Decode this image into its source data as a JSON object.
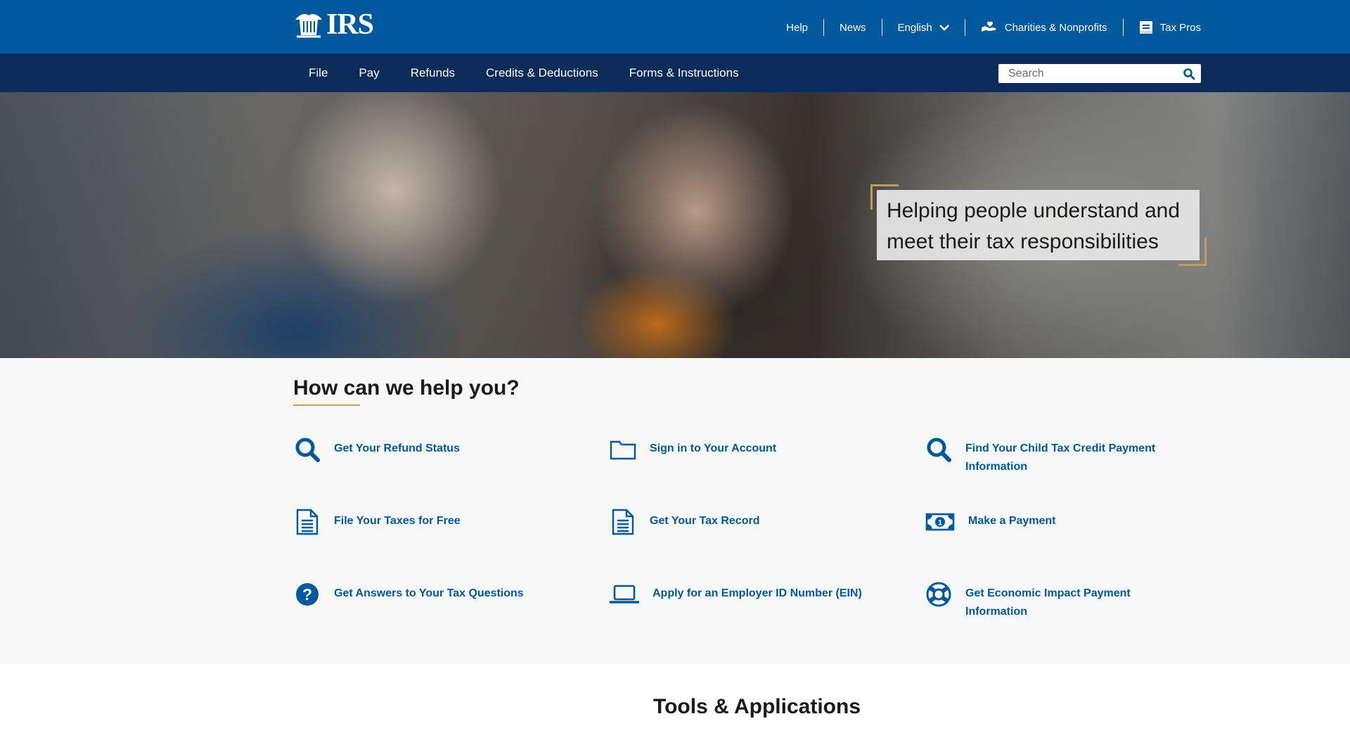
{
  "brand": {
    "logo_text": "IRS"
  },
  "utility_nav": {
    "help": "Help",
    "news": "News",
    "language": "English",
    "charities": "Charities & Nonprofits",
    "tax_pros": "Tax Pros"
  },
  "main_nav": {
    "items": [
      "File",
      "Pay",
      "Refunds",
      "Credits & Deductions",
      "Forms & Instructions"
    ]
  },
  "search": {
    "placeholder": "Search",
    "value": ""
  },
  "hero": {
    "line1": "Helping people understand and",
    "line2": "meet their tax responsibilities"
  },
  "help": {
    "title": "How can we help you?",
    "links": [
      {
        "label": "Get Your Refund Status",
        "icon": "search-icon"
      },
      {
        "label": "Sign in to Your Account",
        "icon": "folder-icon"
      },
      {
        "label": "Find Your Child Tax Credit Payment",
        "label2": "Information",
        "icon": "search-icon"
      },
      {
        "label": "File Your Taxes for Free",
        "icon": "document-icon"
      },
      {
        "label": "Get Your Tax Record",
        "icon": "document-icon"
      },
      {
        "label": "Make a Payment",
        "icon": "money-icon"
      },
      {
        "label": "Get Answers to Your Tax Questions",
        "icon": "question-icon"
      },
      {
        "label": "Apply for an Employer ID Number (EIN)",
        "icon": "laptop-icon"
      },
      {
        "label": "Get Economic Impact Payment",
        "label2": "Information",
        "icon": "lifebuoy-icon"
      }
    ]
  },
  "tools": {
    "title": "Tools & Applications"
  },
  "colors": {
    "header_blue": "#00599c",
    "nav_navy": "#0b2c59",
    "link_blue": "#00599c",
    "accent_gold": "#c39a5f",
    "section_gray": "#f8f8f8"
  }
}
